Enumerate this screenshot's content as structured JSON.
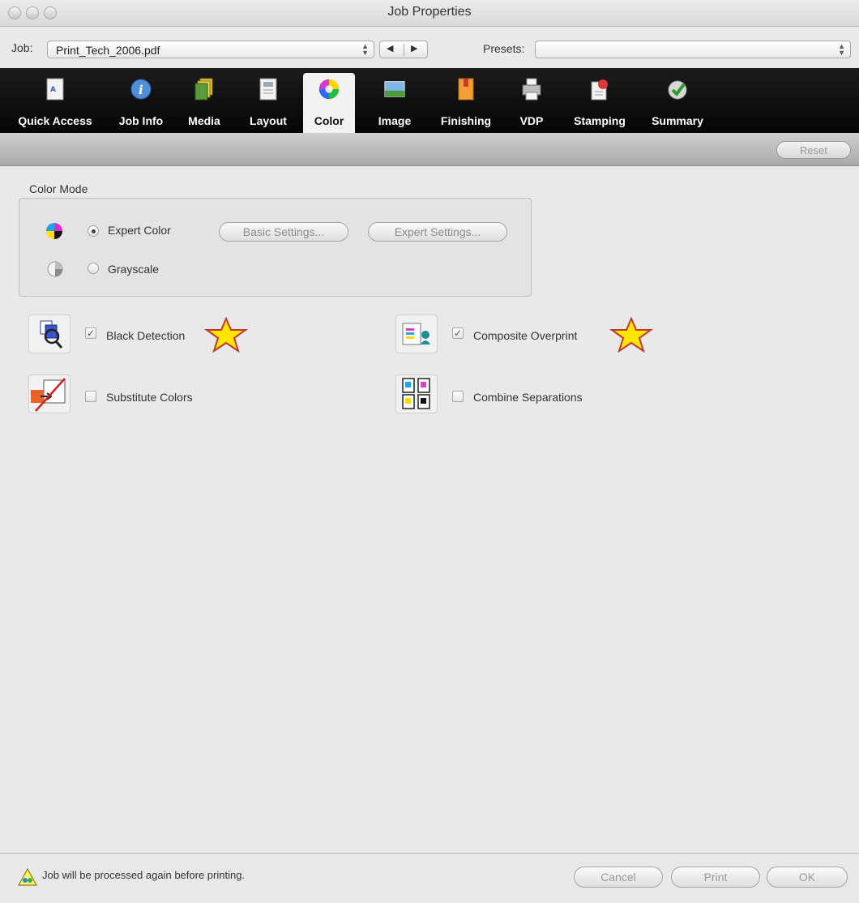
{
  "window": {
    "title": "Job Properties"
  },
  "jobbar": {
    "job_label": "Job:",
    "job_value": "Print_Tech_2006.pdf",
    "presets_label": "Presets:",
    "presets_value": ""
  },
  "tabs": [
    {
      "label": "Quick Access",
      "icon": "quick-access-icon"
    },
    {
      "label": "Job Info",
      "icon": "info-icon"
    },
    {
      "label": "Media",
      "icon": "media-icon"
    },
    {
      "label": "Layout",
      "icon": "layout-icon"
    },
    {
      "label": "Color",
      "icon": "color-wheel-icon",
      "active": true
    },
    {
      "label": "Image",
      "icon": "image-icon"
    },
    {
      "label": "Finishing",
      "icon": "finishing-icon"
    },
    {
      "label": "VDP",
      "icon": "printer-icon"
    },
    {
      "label": "Stamping",
      "icon": "stamping-icon"
    },
    {
      "label": "Summary",
      "icon": "checkmark-icon"
    }
  ],
  "reset_label": "Reset",
  "color_mode": {
    "title": "Color Mode",
    "expert_label": "Expert Color",
    "grayscale_label": "Grayscale",
    "selected": "Expert Color",
    "basic_settings_label": "Basic Settings...",
    "expert_settings_label": "Expert Settings..."
  },
  "options": {
    "black_detection": {
      "label": "Black Detection",
      "checked": true
    },
    "composite_overprint": {
      "label": "Composite Overprint",
      "checked": true
    },
    "substitute_colors": {
      "label": "Substitute Colors",
      "checked": false
    },
    "combine_separations": {
      "label": "Combine Separations",
      "checked": false
    }
  },
  "footer": {
    "status": "Job will be processed again before printing.",
    "cancel_label": "Cancel",
    "print_label": "Print",
    "ok_label": "OK"
  },
  "colors": {
    "tabbar": "#0a0a0a",
    "star_fill": "#ffe600",
    "star_stroke": "#c0392b"
  }
}
